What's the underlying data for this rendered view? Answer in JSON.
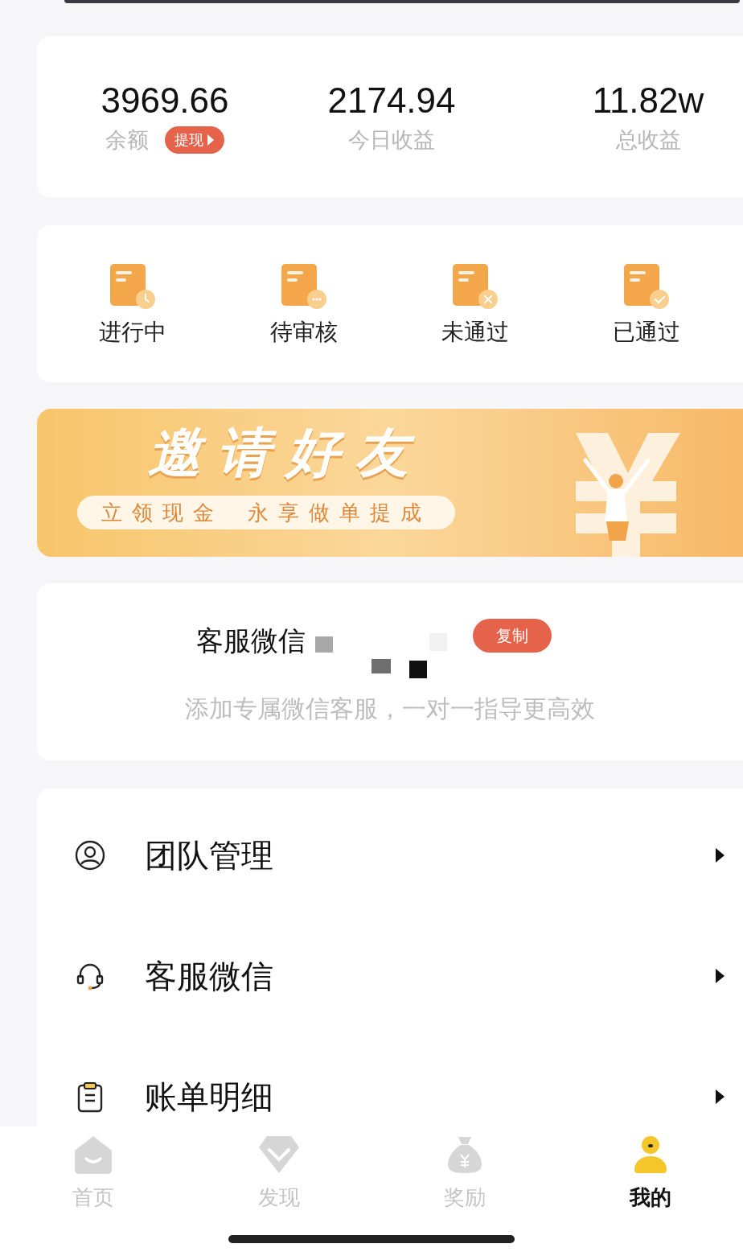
{
  "stats": [
    {
      "value": "3969.66",
      "label": "余额",
      "action": "提现"
    },
    {
      "value": "2174.94",
      "label": "今日收益"
    },
    {
      "value": "11.82w",
      "label": "总收益"
    }
  ],
  "order_status": [
    {
      "label": "进行中",
      "kind": "clock"
    },
    {
      "label": "待审核",
      "kind": "pending"
    },
    {
      "label": "未通过",
      "kind": "rejected"
    },
    {
      "label": "已通过",
      "kind": "approved"
    }
  ],
  "banner": {
    "title": "邀请好友",
    "subtitle": [
      "立领现金",
      "永享做单提成"
    ]
  },
  "wechat": {
    "label": "客服微信",
    "copy_button": "复制",
    "hint": "添加专属微信客服，一对一指导更高效"
  },
  "menu": [
    {
      "label": "团队管理",
      "kind": "team"
    },
    {
      "label": "客服微信",
      "kind": "headset"
    },
    {
      "label": "账单明细",
      "kind": "clipboard"
    }
  ],
  "tabs": [
    {
      "label": "首页",
      "kind": "home",
      "selected": false
    },
    {
      "label": "发现",
      "kind": "discover",
      "selected": false
    },
    {
      "label": "奖励",
      "kind": "reward",
      "selected": false
    },
    {
      "label": "我的",
      "kind": "profile",
      "selected": true
    }
  ]
}
